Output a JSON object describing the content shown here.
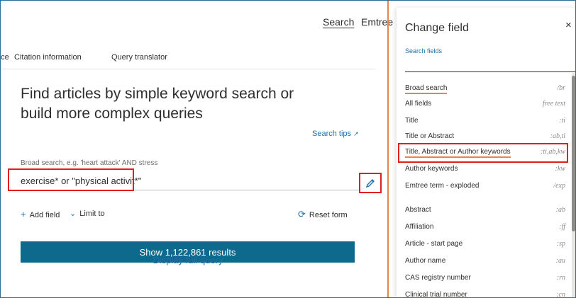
{
  "nav": {
    "search": "Search",
    "emtree": "Emtree"
  },
  "subnav": {
    "previous": "rice",
    "citation": "Citation information",
    "translator": "Query translator"
  },
  "main": {
    "title": "Find articles by simple keyword search or build more complex queries",
    "search_tips": "Search tips",
    "broad_label": "Broad search, e.g. 'heart attack' AND stress",
    "query_value": "exercise* or \"physical activit*\"",
    "add_field": "Add field",
    "limit_to": "Limit to",
    "reset_form": "Reset form",
    "show_results": "Show 1,122,861 results",
    "display_query": "Display full query"
  },
  "panel": {
    "title": "Change field",
    "close": "×",
    "search_fields_label": "Search fields",
    "fields": [
      {
        "name": "Broad search",
        "code": "/br"
      },
      {
        "name": "All fields",
        "code": "free text"
      },
      {
        "name": "Title",
        "code": ":ti"
      },
      {
        "name": "Title or Abstract",
        "code": ":ab,ti"
      },
      {
        "name": "Title, Abstract or Author keywords",
        "code": ":ti,ab,kw"
      },
      {
        "name": "Author keywords",
        "code": ":kw"
      },
      {
        "name": "Emtree term - exploded",
        "code": "/exp"
      },
      {
        "name": "Abstract",
        "code": ":ab"
      },
      {
        "name": "Affiliation",
        "code": ":ff"
      },
      {
        "name": "Article - start page",
        "code": ":sp"
      },
      {
        "name": "Author name",
        "code": ":au"
      },
      {
        "name": "CAS registry number",
        "code": ":rn"
      },
      {
        "name": "Clinical trial number",
        "code": ":cn"
      }
    ]
  },
  "colors": {
    "primary": "#0d6a8c",
    "link": "#1f6fa8",
    "accent_orange": "#e8844a",
    "highlight_red": "#e02020"
  }
}
